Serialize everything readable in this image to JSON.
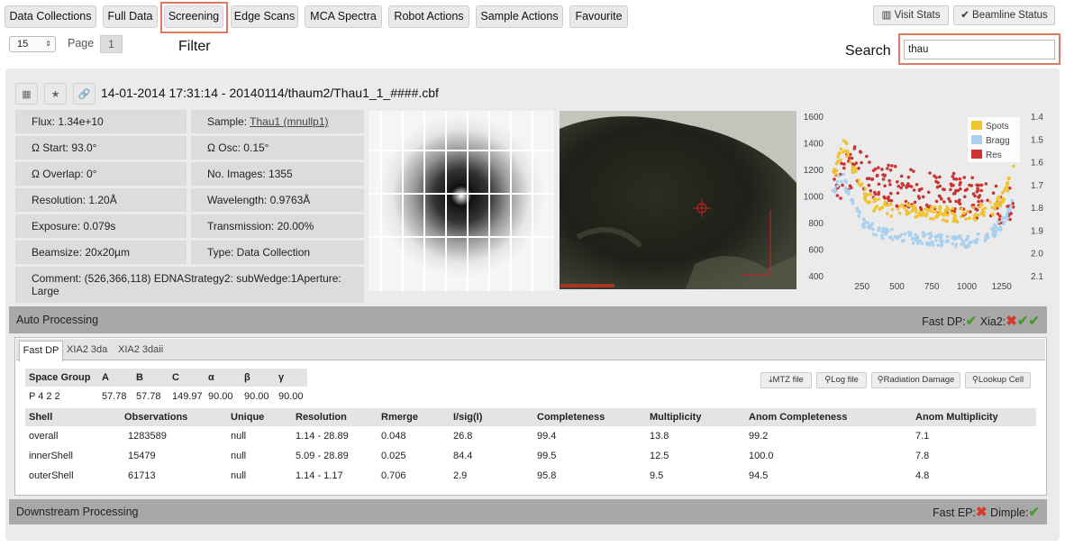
{
  "nav": {
    "tabs": [
      "Data Collections",
      "Full Data",
      "Screening",
      "Edge Scans",
      "MCA Spectra",
      "Robot Actions",
      "Sample Actions",
      "Favourite"
    ],
    "visit_stats": "Visit Stats",
    "beamline_status": "Beamline Status"
  },
  "pager": {
    "per_page": "15",
    "page_label": "Page",
    "page": "1"
  },
  "annotations": {
    "filter": "Filter",
    "search": "Search"
  },
  "search": {
    "value": "thau"
  },
  "collection": {
    "title": "14-01-2014 17:31:14 - 20140114/thaum2/Thau1_1_####.cbf",
    "flux": "Flux: 1.34e+10",
    "sample_label": "Sample: ",
    "sample_link": "Thau1 (mnullp1)",
    "omega_start": "Ω Start: 93.0°",
    "omega_osc": "Ω Osc: 0.15°",
    "omega_overlap": "Ω Overlap: 0°",
    "no_images": "No. Images: 1355",
    "resolution": "Resolution: 1.20Å",
    "wavelength": "Wavelength: 0.9763Å",
    "exposure": "Exposure: 0.079s",
    "transmission": "Transmission: 20.00%",
    "beamsize": "Beamsize: 20x20µm",
    "type": "Type: Data Collection",
    "comment": "Comment:  (526,366,118) EDNAStrategy2: subWedge:1Aperture: Large"
  },
  "chart_data": {
    "type": "scatter",
    "x_ticks": [
      "250",
      "500",
      "750",
      "1000",
      "1250"
    ],
    "y_left_ticks": [
      "1600",
      "1400",
      "1200",
      "1000",
      "800",
      "600",
      "400"
    ],
    "y_right_ticks": [
      "1.4",
      "1.5",
      "1.6",
      "1.7",
      "1.8",
      "1.9",
      "2.0",
      "2.1"
    ],
    "xlim": [
      0,
      1355
    ],
    "ylim_left": [
      400,
      1600
    ],
    "ylim_right": [
      1.4,
      2.1
    ],
    "legend_placement": "top-right",
    "series": [
      {
        "name": "Spots",
        "color": "#f0c330",
        "trend": {
          "x": [
            40,
            80,
            120,
            160,
            200,
            250,
            320,
            400,
            500,
            600,
            700,
            800,
            900,
            1000,
            1100,
            1200,
            1250,
            1300,
            1340
          ],
          "y": [
            1170,
            1260,
            1400,
            1300,
            1180,
            1050,
            950,
            910,
            890,
            900,
            880,
            870,
            860,
            850,
            880,
            920,
            980,
            1080,
            1210
          ]
        }
      },
      {
        "name": "Bragg",
        "color": "#a8d0ef",
        "trend": {
          "x": [
            40,
            80,
            120,
            160,
            200,
            250,
            320,
            400,
            500,
            600,
            700,
            800,
            900,
            1000,
            1100,
            1200,
            1250,
            1300,
            1340
          ],
          "y": [
            1040,
            1110,
            1130,
            1000,
            900,
            820,
            760,
            720,
            700,
            690,
            680,
            670,
            660,
            660,
            690,
            740,
            800,
            880,
            950
          ]
        }
      },
      {
        "name": "Res",
        "color": "#cc3333",
        "trend": {
          "x": [
            40,
            80,
            120,
            160,
            200,
            250,
            320,
            400,
            500,
            600,
            700,
            800,
            900,
            1000,
            1100,
            1200,
            1250,
            1300,
            1340
          ],
          "y": [
            1.72,
            1.68,
            1.66,
            1.64,
            1.6,
            1.64,
            1.68,
            1.7,
            1.71,
            1.72,
            1.73,
            1.74,
            1.74,
            1.75,
            1.76,
            1.78,
            1.79,
            1.8,
            1.8
          ]
        }
      }
    ]
  },
  "auto_processing": {
    "title": "Auto Processing",
    "fast_dp_label": "Fast DP:",
    "xia2_label": "Xia2:",
    "tabs": [
      "Fast DP",
      "XIA2 3da",
      "XIA2 3daii"
    ],
    "buttons": {
      "mtz": "MTZ file",
      "log": "Log file",
      "rad": "Radiation Damage",
      "cell": "Lookup Cell"
    },
    "cell_headers": [
      "Space Group",
      "A",
      "B",
      "C",
      "α",
      "β",
      "γ"
    ],
    "cell_values": [
      "P 4 2 2",
      "57.78",
      "57.78",
      "149.97",
      "90.00",
      "90.00",
      "90.00"
    ],
    "stat_headers": [
      "Shell",
      "Observations",
      "Unique",
      "Resolution",
      "Rmerge",
      "I/sig(I)",
      "Completeness",
      "Multiplicity",
      "Anom Completeness",
      "Anom Multiplicity"
    ],
    "stat_rows": [
      [
        "overall",
        "1283589",
        "null",
        "1.14 - 28.89",
        "0.048",
        "26.8",
        "99.4",
        "13.8",
        "99.2",
        "7.1"
      ],
      [
        "innerShell",
        "15479",
        "null",
        "5.09 - 28.89",
        "0.025",
        "84.4",
        "99.5",
        "12.5",
        "100.0",
        "7.8"
      ],
      [
        "outerShell",
        "61713",
        "null",
        "1.14 - 1.17",
        "0.706",
        "2.9",
        "95.8",
        "9.5",
        "94.5",
        "4.8"
      ]
    ]
  },
  "downstream": {
    "title": "Downstream Processing",
    "fast_ep_label": "Fast EP:",
    "dimple_label": "Dimple:"
  }
}
